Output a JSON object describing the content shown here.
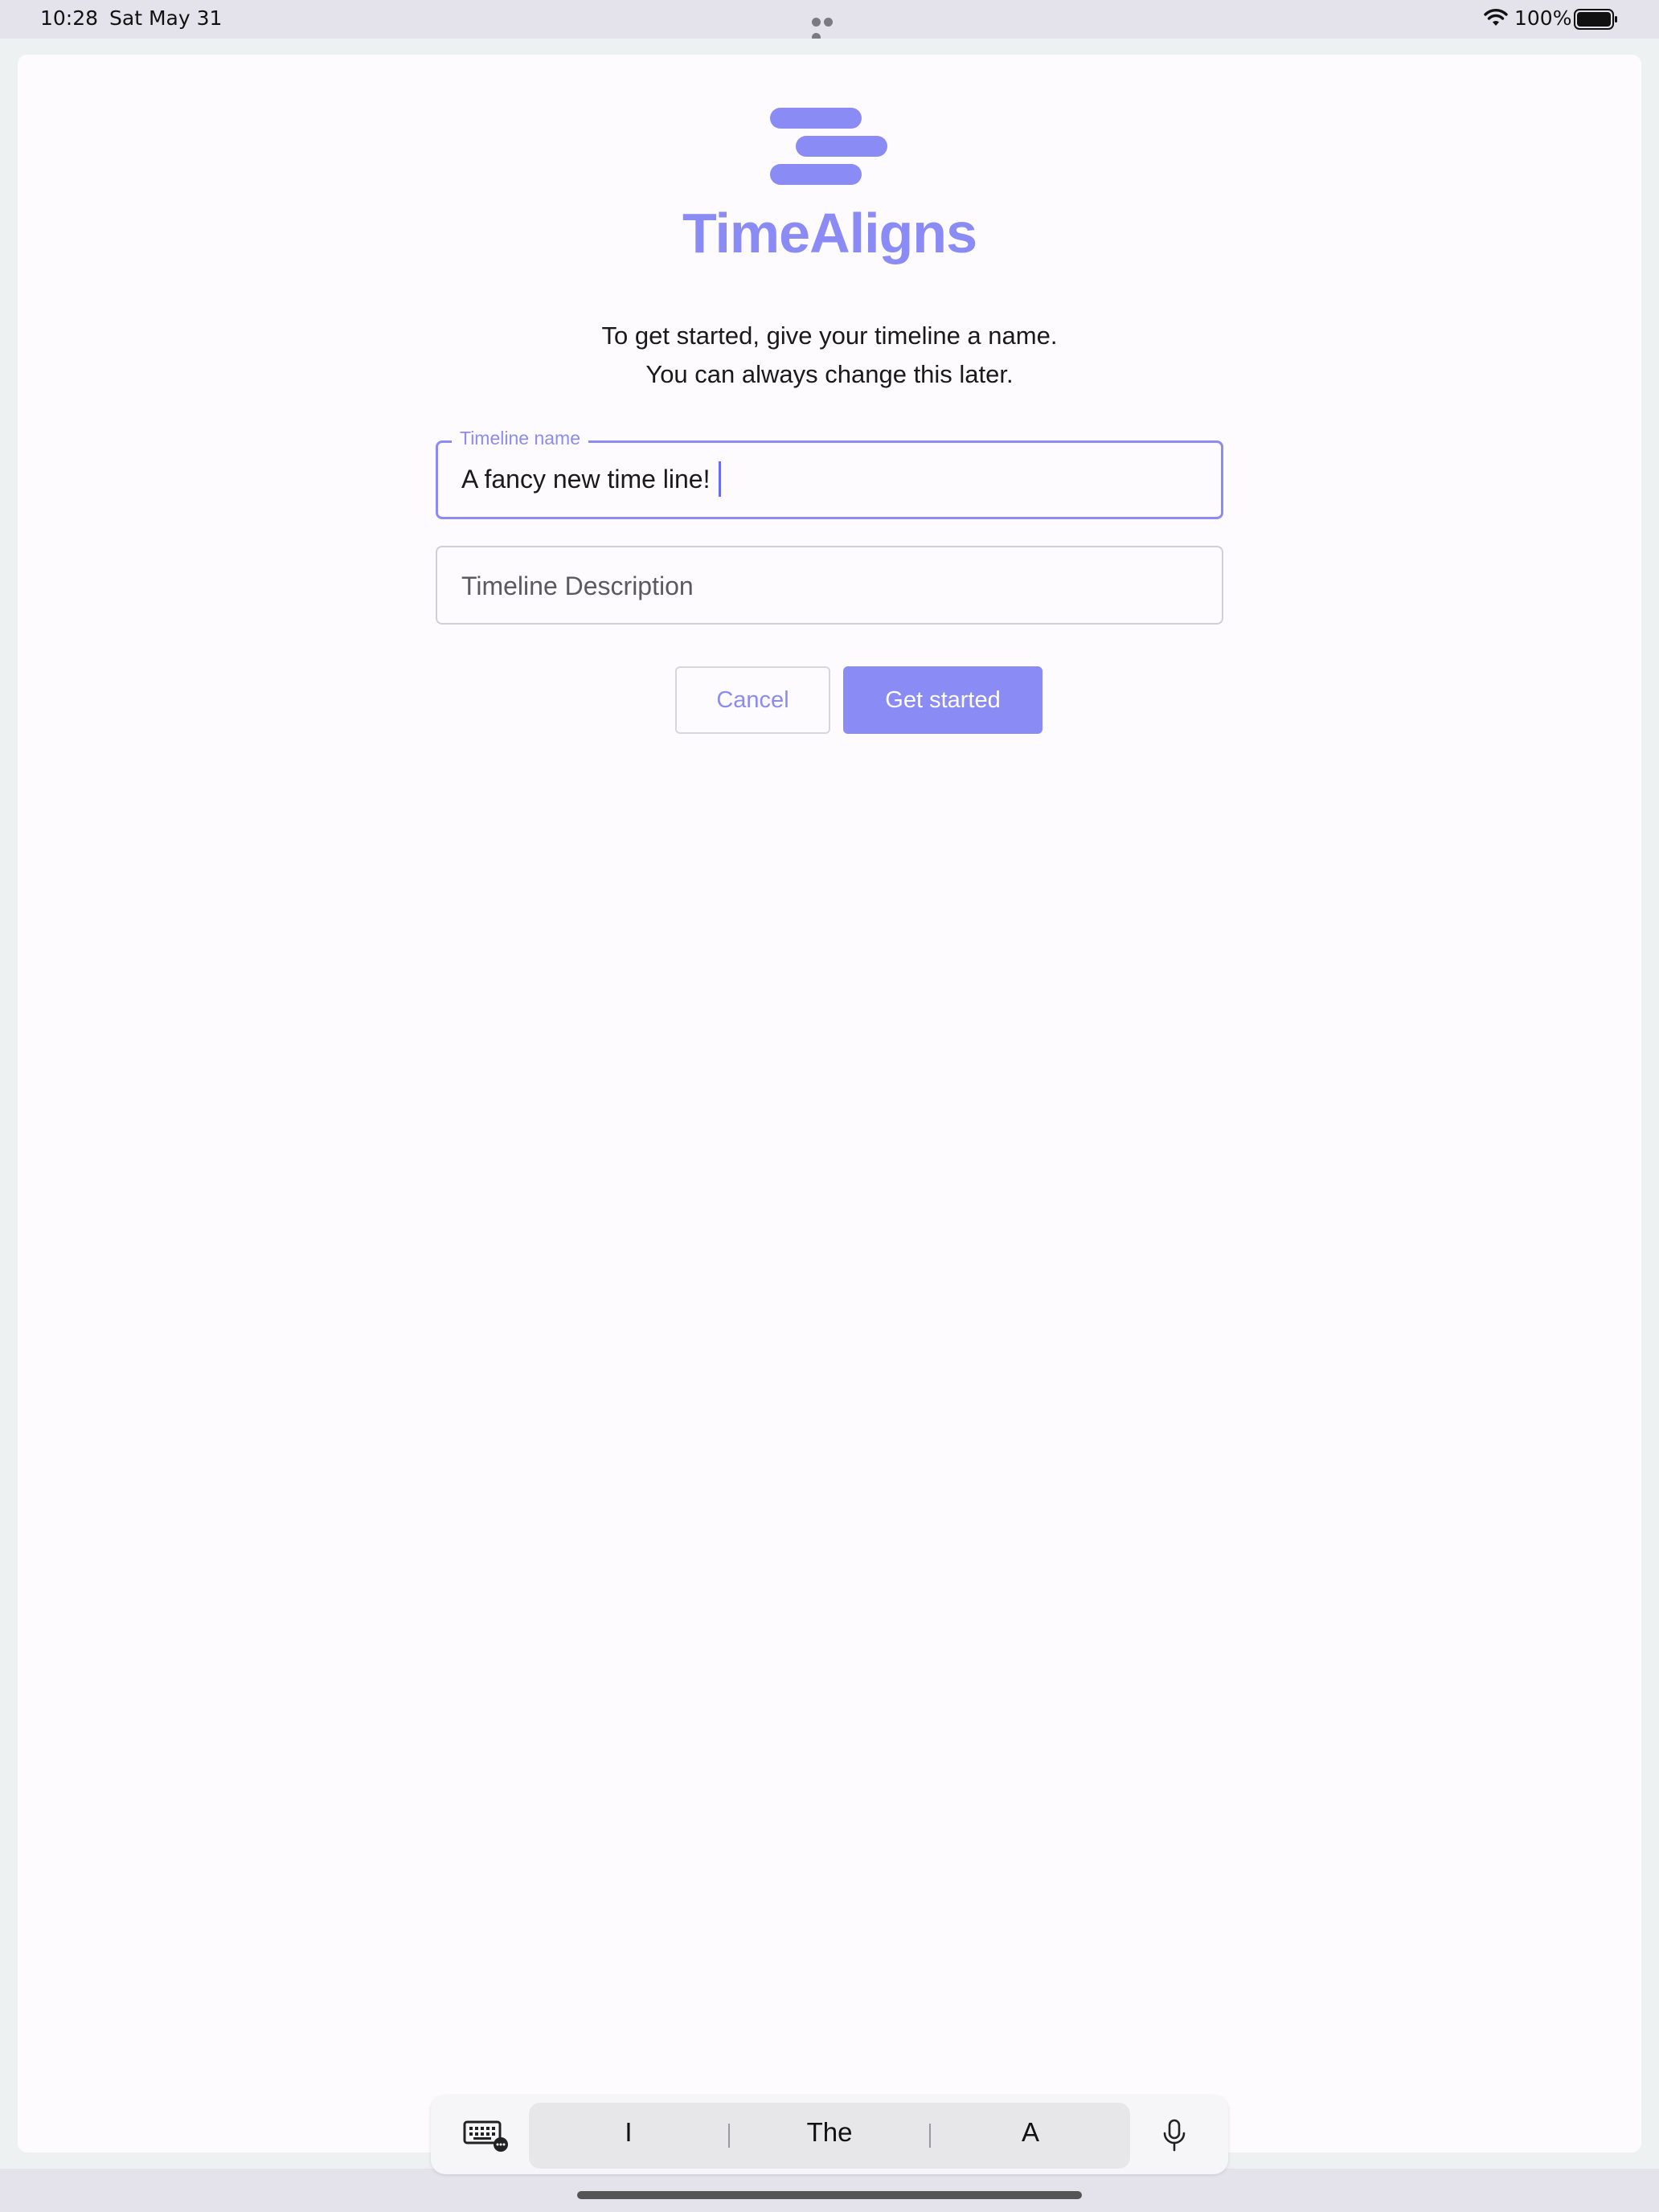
{
  "status_bar": {
    "time": "10:28",
    "date": "Sat May 31",
    "battery_percent": "100%",
    "icons": [
      "wifi-icon",
      "battery-icon"
    ]
  },
  "app": {
    "brand": "TimeAligns",
    "logo": "timealigns-logo",
    "intro_line_1": "To get started, give your timeline a name.",
    "intro_line_2": "You can always change this later.",
    "name_field": {
      "label": "Timeline name",
      "value": "A fancy new time line!"
    },
    "description_field": {
      "placeholder": "Timeline Description",
      "value": ""
    },
    "cancel_label": "Cancel",
    "start_label": "Get started",
    "colors": {
      "accent": "#8b8bf6",
      "text": "#1a1a1a",
      "border": "#cfcfd6"
    }
  },
  "keyboard_bar": {
    "suggestions": [
      "I",
      "The",
      "A"
    ],
    "icons": [
      "keyboard-icon",
      "microphone-icon"
    ]
  }
}
